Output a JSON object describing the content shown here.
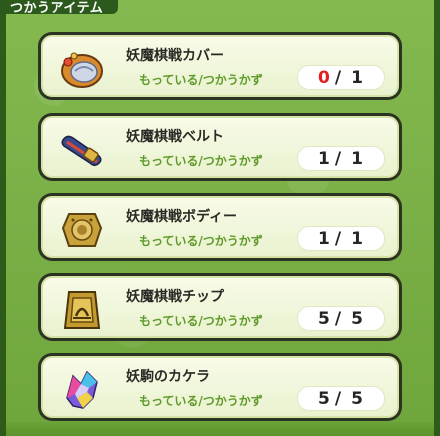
{
  "section": {
    "title": "つかうアイテム"
  },
  "items": [
    {
      "name": "妖魔棋戦カバー",
      "sub_label": "もっている/つかうかず",
      "have": "0",
      "slash": "/",
      "need": "1",
      "have_short": true,
      "icon": "cover-icon"
    },
    {
      "name": "妖魔棋戦ベルト",
      "sub_label": "もっている/つかうかず",
      "have": "1",
      "slash": "/",
      "need": "1",
      "have_short": false,
      "icon": "belt-icon"
    },
    {
      "name": "妖魔棋戦ボディー",
      "sub_label": "もっている/つかうかず",
      "have": "1",
      "slash": "/",
      "need": "1",
      "have_short": false,
      "icon": "body-icon"
    },
    {
      "name": "妖魔棋戦チップ",
      "sub_label": "もっている/つかうかず",
      "have": "5",
      "slash": "/",
      "need": "5",
      "have_short": false,
      "icon": "chip-icon"
    },
    {
      "name": "妖駒のカケラ",
      "sub_label": "もっている/つかうかず",
      "have": "5",
      "slash": "/",
      "need": "5",
      "have_short": false,
      "icon": "fragment-icon"
    }
  ],
  "colors": {
    "shortage": "#e01f1f",
    "sub_label": "#5f9a2a",
    "card_border": "#2b3322"
  }
}
